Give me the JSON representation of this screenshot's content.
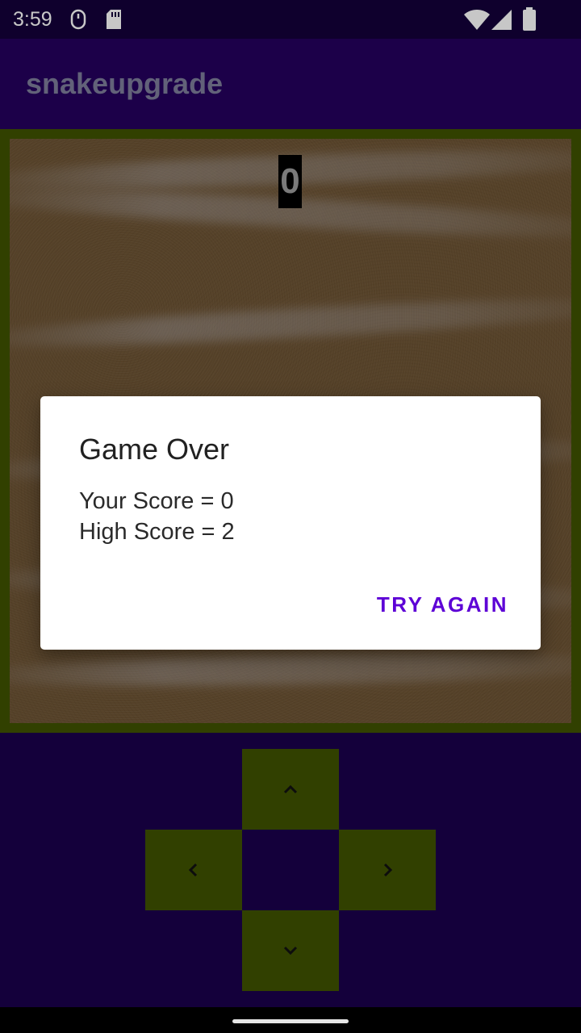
{
  "status_bar": {
    "time": "3:59",
    "icons": [
      "mouse-icon",
      "sd-card-icon",
      "wifi-icon",
      "signal-icon",
      "battery-icon"
    ]
  },
  "app_bar": {
    "title": "snakeupgrade"
  },
  "game": {
    "score": "0",
    "background": "sand-texture"
  },
  "dialog": {
    "title": "Game Over",
    "your_score": "Your Score = 0",
    "high_score": "High Score = 2",
    "button_label": "TRY AGAIN"
  },
  "controls": {
    "up_icon": "chevron-up-icon",
    "left_icon": "chevron-left-icon",
    "right_icon": "chevron-right-icon",
    "down_icon": "chevron-down-icon"
  },
  "colors": {
    "status_bar": "#14003a",
    "app_bar": "#25005e",
    "screen_background": "#1a004c",
    "border_green": "#3f5200",
    "accent": "#5d00d6"
  }
}
